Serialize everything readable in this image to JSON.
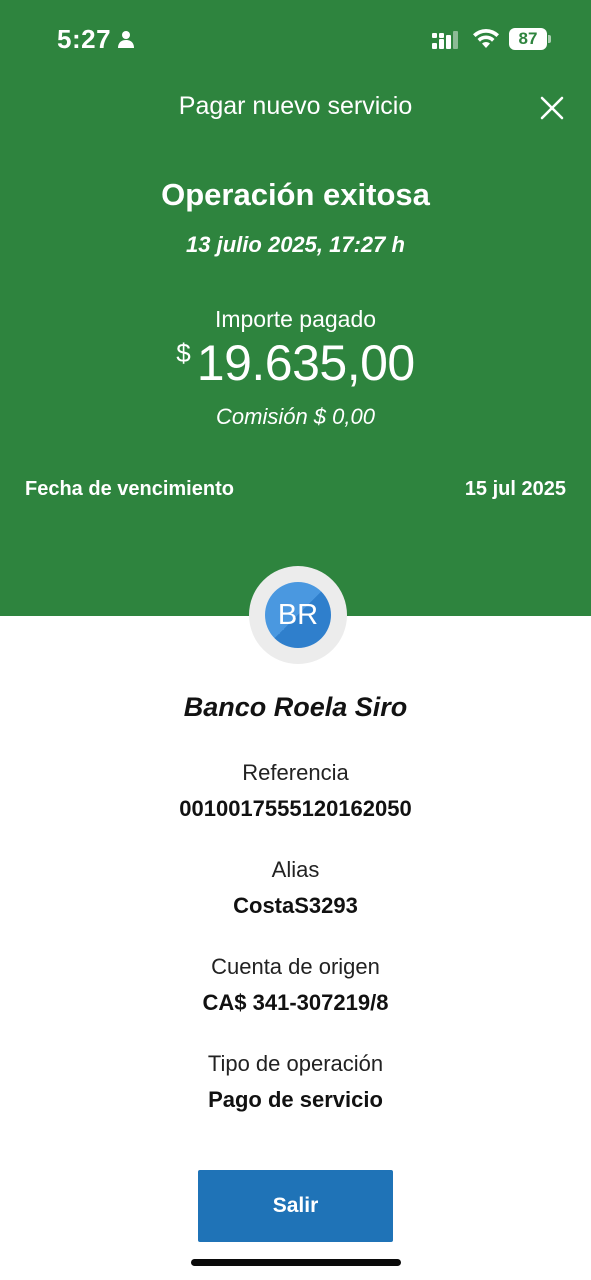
{
  "status_bar": {
    "time": "5:27",
    "battery": "87",
    "icons": [
      "person-icon",
      "signal-icon",
      "wifi-icon",
      "battery-icon"
    ]
  },
  "header": {
    "title": "Pagar nuevo servicio",
    "close_icon": "close-icon"
  },
  "result": {
    "title": "Operación exitosa",
    "datetime": "13 julio 2025, 17:27 h",
    "amount_label": "Importe pagado",
    "currency_symbol": "$",
    "amount": "19.635,00",
    "commission": "Comisión  $ 0,00"
  },
  "due_date": {
    "label": "Fecha de vencimiento",
    "value": "15 jul 2025"
  },
  "payee": {
    "initials": "BR",
    "name": "Banco Roela Siro"
  },
  "details": [
    {
      "label": "Referencia",
      "value": "0010017555120162050"
    },
    {
      "label": "Alias",
      "value": "CostaS3293"
    },
    {
      "label": "Cuenta de origen",
      "value": "CA$ 341-307219/8"
    },
    {
      "label": "Tipo de operación",
      "value": "Pago de servicio"
    }
  ],
  "actions": {
    "exit_label": "Salir"
  },
  "colors": {
    "header_green": "#2e843e",
    "button_blue": "#1f73b7",
    "avatar_blue": "#4a98e0"
  }
}
